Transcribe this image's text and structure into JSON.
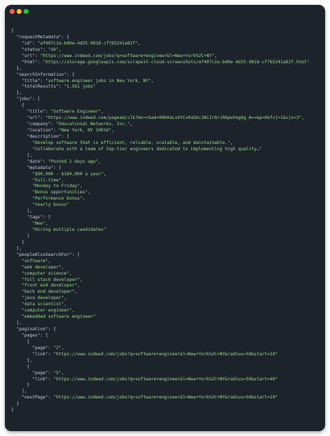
{
  "colors": {
    "window_bg": "#1d232b",
    "traffic_red": "#ff5f57",
    "traffic_yellow": "#febc2e",
    "traffic_green": "#28c840",
    "punct": "#c9d1d9",
    "key": "#c9d1d9",
    "string": "#9fdc8f"
  },
  "code_lines": [
    [
      {
        "t": "{",
        "c": "p"
      }
    ],
    [
      {
        "t": "  ",
        "c": "p"
      },
      {
        "t": "\"requestMetadata\"",
        "c": "k"
      },
      {
        "t": ": {",
        "c": "p"
      }
    ],
    [
      {
        "t": "    ",
        "c": "p"
      },
      {
        "t": "\"id\"",
        "c": "k"
      },
      {
        "t": ": ",
        "c": "p"
      },
      {
        "t": "\"af407c2a-bd0e-4d25-9818-cf765241a81f\"",
        "c": "s"
      },
      {
        "t": ",",
        "c": "p"
      }
    ],
    [
      {
        "t": "    ",
        "c": "p"
      },
      {
        "t": "\"status\"",
        "c": "k"
      },
      {
        "t": ": ",
        "c": "p"
      },
      {
        "t": "\"ok\"",
        "c": "s"
      },
      {
        "t": ",",
        "c": "p"
      }
    ],
    [
      {
        "t": "    ",
        "c": "p"
      },
      {
        "t": "\"url\"",
        "c": "k"
      },
      {
        "t": ": ",
        "c": "p"
      },
      {
        "t": "\"https://www.indeed.com/jobs?q=software+engineer&l=New+York%2C+NY\"",
        "c": "s"
      },
      {
        "t": ",",
        "c": "p"
      }
    ],
    [
      {
        "t": "    ",
        "c": "p"
      },
      {
        "t": "\"html\"",
        "c": "k"
      },
      {
        "t": ": ",
        "c": "p"
      },
      {
        "t": "\"https://storage.googleapis.com/scrapeit-cloud-screenshots/af407c2a-bd0e-4d25-9818-cf765241a81f.html\"",
        "c": "s"
      }
    ],
    [
      {
        "t": "  },",
        "c": "p"
      }
    ],
    [
      {
        "t": "  ",
        "c": "p"
      },
      {
        "t": "\"searchInformation\"",
        "c": "k"
      },
      {
        "t": ": {",
        "c": "p"
      }
    ],
    [
      {
        "t": "    ",
        "c": "p"
      },
      {
        "t": "\"title\"",
        "c": "k"
      },
      {
        "t": ": ",
        "c": "p"
      },
      {
        "t": "\"software engineer jobs in New York, NY\"",
        "c": "s"
      },
      {
        "t": ",",
        "c": "p"
      }
    ],
    [
      {
        "t": "    ",
        "c": "p"
      },
      {
        "t": "\"totalResults\"",
        "c": "k"
      },
      {
        "t": ": ",
        "c": "p"
      },
      {
        "t": "\"1,561 jobs\"",
        "c": "s"
      }
    ],
    [
      {
        "t": "  },",
        "c": "p"
      }
    ],
    [
      {
        "t": "  ",
        "c": "p"
      },
      {
        "t": "\"jobs\"",
        "c": "k"
      },
      {
        "t": ": [",
        "c": "p"
      }
    ],
    [
      {
        "t": "    {",
        "c": "p"
      }
    ],
    [
      {
        "t": "      ",
        "c": "p"
      },
      {
        "t": "\"title\"",
        "c": "k"
      },
      {
        "t": ": ",
        "c": "p"
      },
      {
        "t": "\"Software Engineer\"",
        "c": "s"
      },
      {
        "t": ",",
        "c": "p"
      }
    ],
    [
      {
        "t": "      ",
        "c": "p"
      },
      {
        "t": "\"url\"",
        "c": "k"
      },
      {
        "t": ": ",
        "c": "p"
      },
      {
        "t": "\"https://www.indeed.com/pagead/clk?mo=r&ad=09b0aLs9tCv0aSkcJWiIr8riR6pwVeg8g_A==&p=0&fvj=1&vjs=3\"",
        "c": "s"
      },
      {
        "t": ",",
        "c": "p"
      }
    ],
    [
      {
        "t": "      ",
        "c": "p"
      },
      {
        "t": "\"company\"",
        "c": "k"
      },
      {
        "t": ": ",
        "c": "p"
      },
      {
        "t": "\"Educational Networks, Inc.\"",
        "c": "s"
      },
      {
        "t": ",",
        "c": "p"
      }
    ],
    [
      {
        "t": "      ",
        "c": "p"
      },
      {
        "t": "\"location\"",
        "c": "k"
      },
      {
        "t": ": ",
        "c": "p"
      },
      {
        "t": "\"New York, NY 10016\"",
        "c": "s"
      },
      {
        "t": ",",
        "c": "p"
      }
    ],
    [
      {
        "t": "      ",
        "c": "p"
      },
      {
        "t": "\"description\"",
        "c": "k"
      },
      {
        "t": ": [",
        "c": "p"
      }
    ],
    [
      {
        "t": "        ",
        "c": "p"
      },
      {
        "t": "\"Develop software that is efficient, reliable, scalable, and maintainable.\"",
        "c": "s"
      },
      {
        "t": ",",
        "c": "p"
      }
    ],
    [
      {
        "t": "        ",
        "c": "p"
      },
      {
        "t": "\"Collaborate with a team of top-tier engineers dedicated to implementing high quality…\"",
        "c": "s"
      }
    ],
    [
      {
        "t": "      ],",
        "c": "p"
      }
    ],
    [
      {
        "t": "      ",
        "c": "p"
      },
      {
        "t": "\"date\"",
        "c": "k"
      },
      {
        "t": ": ",
        "c": "p"
      },
      {
        "t": "\"Posted 2 days ago\"",
        "c": "s"
      },
      {
        "t": ",",
        "c": "p"
      }
    ],
    [
      {
        "t": "      ",
        "c": "p"
      },
      {
        "t": "\"metadata\"",
        "c": "k"
      },
      {
        "t": ": [",
        "c": "p"
      }
    ],
    [
      {
        "t": "        ",
        "c": "p"
      },
      {
        "t": "\"$90,000 - $160,000 a year\"",
        "c": "s"
      },
      {
        "t": ",",
        "c": "p"
      }
    ],
    [
      {
        "t": "        ",
        "c": "p"
      },
      {
        "t": "\"Full-time\"",
        "c": "s"
      },
      {
        "t": ",",
        "c": "p"
      }
    ],
    [
      {
        "t": "        ",
        "c": "p"
      },
      {
        "t": "\"Monday to Friday\"",
        "c": "s"
      },
      {
        "t": ",",
        "c": "p"
      }
    ],
    [
      {
        "t": "        ",
        "c": "p"
      },
      {
        "t": "\"Bonus opportunities\"",
        "c": "s"
      },
      {
        "t": ",",
        "c": "p"
      }
    ],
    [
      {
        "t": "        ",
        "c": "p"
      },
      {
        "t": "\"Performance bonus\"",
        "c": "s"
      },
      {
        "t": ",",
        "c": "p"
      }
    ],
    [
      {
        "t": "        ",
        "c": "p"
      },
      {
        "t": "\"Yearly bonus\"",
        "c": "s"
      }
    ],
    [
      {
        "t": "      ],",
        "c": "p"
      }
    ],
    [
      {
        "t": "      ",
        "c": "p"
      },
      {
        "t": "\"tags\"",
        "c": "k"
      },
      {
        "t": ": [",
        "c": "p"
      }
    ],
    [
      {
        "t": "        ",
        "c": "p"
      },
      {
        "t": "\"New\"",
        "c": "s"
      },
      {
        "t": ",",
        "c": "p"
      }
    ],
    [
      {
        "t": "        ",
        "c": "p"
      },
      {
        "t": "\"Hiring multiple candidates\"",
        "c": "s"
      }
    ],
    [
      {
        "t": "      ]",
        "c": "p"
      }
    ],
    [
      {
        "t": "    }",
        "c": "p"
      }
    ],
    [
      {
        "t": "  ],",
        "c": "p"
      }
    ],
    [
      {
        "t": "  ",
        "c": "p"
      },
      {
        "t": "\"peopleAlsoSearchFor\"",
        "c": "k"
      },
      {
        "t": ": [",
        "c": "p"
      }
    ],
    [
      {
        "t": "    ",
        "c": "p"
      },
      {
        "t": "\"software\"",
        "c": "s"
      },
      {
        "t": ",",
        "c": "p"
      }
    ],
    [
      {
        "t": "    ",
        "c": "p"
      },
      {
        "t": "\"web developer\"",
        "c": "s"
      },
      {
        "t": ",",
        "c": "p"
      }
    ],
    [
      {
        "t": "    ",
        "c": "p"
      },
      {
        "t": "\"computer science\"",
        "c": "s"
      },
      {
        "t": ",",
        "c": "p"
      }
    ],
    [
      {
        "t": "    ",
        "c": "p"
      },
      {
        "t": "\"full stack developer\"",
        "c": "s"
      },
      {
        "t": ",",
        "c": "p"
      }
    ],
    [
      {
        "t": "    ",
        "c": "p"
      },
      {
        "t": "\"front end developer\"",
        "c": "s"
      },
      {
        "t": ",",
        "c": "p"
      }
    ],
    [
      {
        "t": "    ",
        "c": "p"
      },
      {
        "t": "\"back end developer\"",
        "c": "s"
      },
      {
        "t": ",",
        "c": "p"
      }
    ],
    [
      {
        "t": "    ",
        "c": "p"
      },
      {
        "t": "\"java developer\"",
        "c": "s"
      },
      {
        "t": ",",
        "c": "p"
      }
    ],
    [
      {
        "t": "    ",
        "c": "p"
      },
      {
        "t": "\"data scientist\"",
        "c": "s"
      },
      {
        "t": ",",
        "c": "p"
      }
    ],
    [
      {
        "t": "    ",
        "c": "p"
      },
      {
        "t": "\"computer engineer\"",
        "c": "s"
      },
      {
        "t": ",",
        "c": "p"
      }
    ],
    [
      {
        "t": "    ",
        "c": "p"
      },
      {
        "t": "\"embedded software engineer\"",
        "c": "s"
      }
    ],
    [
      {
        "t": "  ],",
        "c": "p"
      }
    ],
    [
      {
        "t": "  ",
        "c": "p"
      },
      {
        "t": "\"pagination\"",
        "c": "k"
      },
      {
        "t": ": {",
        "c": "p"
      }
    ],
    [
      {
        "t": "    ",
        "c": "p"
      },
      {
        "t": "\"pages\"",
        "c": "k"
      },
      {
        "t": ": [",
        "c": "p"
      }
    ],
    [
      {
        "t": "      {",
        "c": "p"
      }
    ],
    [
      {
        "t": "        ",
        "c": "p"
      },
      {
        "t": "\"page\"",
        "c": "k"
      },
      {
        "t": ": ",
        "c": "p"
      },
      {
        "t": "\"2\"",
        "c": "s"
      },
      {
        "t": ",",
        "c": "p"
      }
    ],
    [
      {
        "t": "        ",
        "c": "p"
      },
      {
        "t": "\"link\"",
        "c": "k"
      },
      {
        "t": ": ",
        "c": "p"
      },
      {
        "t": "\"https://www.indeed.com/jobs?q=software+engineer&l=New+York%2C+NY&radius=50&start=10\"",
        "c": "s"
      }
    ],
    [
      {
        "t": "      },",
        "c": "p"
      }
    ],
    [
      {
        "t": "      {",
        "c": "p"
      }
    ],
    [
      {
        "t": "        ",
        "c": "p"
      },
      {
        "t": "\"page\"",
        "c": "k"
      },
      {
        "t": ": ",
        "c": "p"
      },
      {
        "t": "\"5\"",
        "c": "s"
      },
      {
        "t": ",",
        "c": "p"
      }
    ],
    [
      {
        "t": "        ",
        "c": "p"
      },
      {
        "t": "\"link\"",
        "c": "k"
      },
      {
        "t": ": ",
        "c": "p"
      },
      {
        "t": "\"https://www.indeed.com/jobs?q=software+engineer&l=New+York%2C+NY&radius=50&start=40\"",
        "c": "s"
      }
    ],
    [
      {
        "t": "      }",
        "c": "p"
      }
    ],
    [
      {
        "t": "    ],",
        "c": "p"
      }
    ],
    [
      {
        "t": "    ",
        "c": "p"
      },
      {
        "t": "\"nextPage\"",
        "c": "k"
      },
      {
        "t": ": ",
        "c": "p"
      },
      {
        "t": "\"https://www.indeed.com/jobs?q=software+engineer&l=New+York%2C+NY&radius=50&start=10\"",
        "c": "s"
      }
    ],
    [
      {
        "t": "  }",
        "c": "p"
      }
    ],
    [
      {
        "t": "}",
        "c": "p"
      }
    ]
  ]
}
